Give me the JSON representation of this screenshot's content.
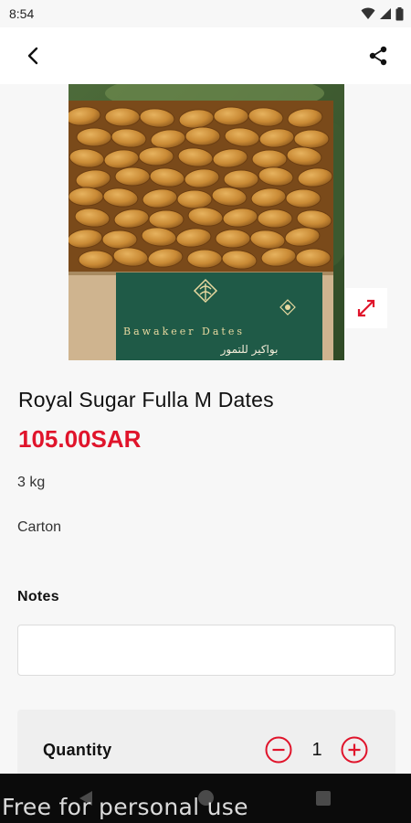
{
  "status_bar": {
    "time": "8:54",
    "icons": [
      "wifi-icon",
      "signal-icon",
      "battery-icon"
    ]
  },
  "app_bar": {
    "back_icon": "chevron-left-icon",
    "share_icon": "share-icon"
  },
  "product": {
    "image_brand_text": "Bawakeer Dates",
    "image_brand_text_ar": "بواكير للتمور",
    "expand_icon": "expand-diagonal-icon",
    "title": "Royal Sugar Fulla M Dates",
    "price": "105.00SAR",
    "weight": "3 kg",
    "packaging": "Carton"
  },
  "notes": {
    "label": "Notes",
    "value": "",
    "placeholder": ""
  },
  "quantity": {
    "label": "Quantity",
    "value": "1",
    "minus_icon": "minus-circle-icon",
    "plus_icon": "plus-circle-icon"
  },
  "nav_bar": {
    "icons": [
      "nav-back-icon",
      "nav-home-icon",
      "nav-recents-icon"
    ]
  },
  "watermark": "Free for personal use",
  "colors": {
    "accent": "#e0142b",
    "background": "#f7f7f7",
    "nav_bar": "#0b0b0b",
    "box_label": "#1f5a47"
  }
}
